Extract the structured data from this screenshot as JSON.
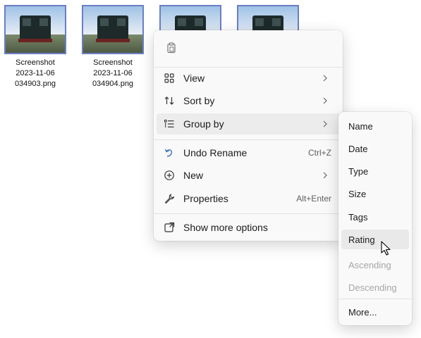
{
  "files": [
    {
      "line1": "Screenshot",
      "line2": "2023-11-06",
      "line3": "034903.png"
    },
    {
      "line1": "Screenshot",
      "line2": "2023-11-06",
      "line3": "034904.png"
    },
    {
      "line1": "",
      "line2": "",
      "line3": ""
    },
    {
      "line1": "",
      "line2": "",
      "line3": ""
    }
  ],
  "context_menu": {
    "top_icon": "paste-icon",
    "items": [
      {
        "label": "View",
        "icon": "view-grid-icon",
        "has_submenu": true
      },
      {
        "label": "Sort by",
        "icon": "sort-icon",
        "has_submenu": true
      },
      {
        "label": "Group by",
        "icon": "group-icon",
        "has_submenu": true,
        "hovered": true
      },
      {
        "label": "Undo Rename",
        "icon": "undo-icon",
        "shortcut": "Ctrl+Z"
      },
      {
        "label": "New",
        "icon": "new-plus-icon",
        "has_submenu": true
      },
      {
        "label": "Properties",
        "icon": "wrench-icon",
        "shortcut": "Alt+Enter"
      },
      {
        "label": "Show more options",
        "icon": "show-more-icon"
      }
    ]
  },
  "group_submenu": {
    "items": [
      {
        "label": "Name"
      },
      {
        "label": "Date"
      },
      {
        "label": "Type"
      },
      {
        "label": "Size"
      },
      {
        "label": "Tags"
      },
      {
        "label": "Rating",
        "hovered": true
      },
      {
        "label": "Ascending",
        "disabled": true
      },
      {
        "label": "Descending",
        "disabled": true
      },
      {
        "label": "More..."
      }
    ]
  },
  "colors": {
    "accent_border": "#6b7fc4",
    "menu_bg": "#f9f9f9",
    "hover_bg": "#ececec",
    "disabled_text": "#a6a6a6"
  }
}
